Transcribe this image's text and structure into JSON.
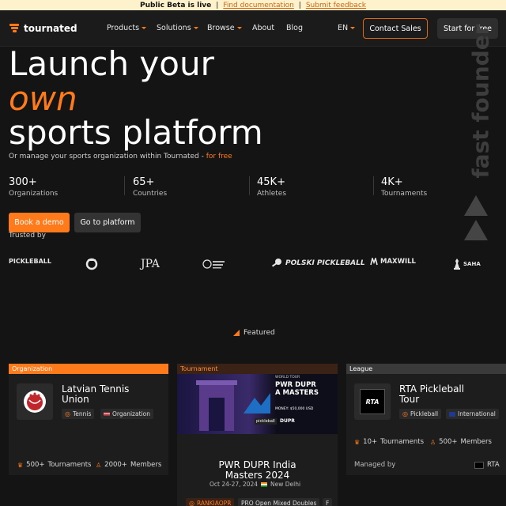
{
  "banner": {
    "status": "Public Beta is live",
    "sep": "|",
    "doc_link": "Find documentation",
    "feedback_link": "Submit feedback"
  },
  "nav": {
    "brand": "tournated",
    "items": [
      {
        "label": "Products",
        "dropdown": true
      },
      {
        "label": "Solutions",
        "dropdown": true
      },
      {
        "label": "Browse",
        "dropdown": true
      },
      {
        "label": "About",
        "dropdown": false
      },
      {
        "label": "Blog",
        "dropdown": false
      }
    ],
    "language": "EN",
    "contact_sales": "Contact Sales",
    "start_free": "Start for free"
  },
  "hero": {
    "line1": "Launch your",
    "line2": "own",
    "line3": "sports platform",
    "subtitle": "Or manage your sports organization within Tournated - ",
    "subtitle_highlight": "for free",
    "vertical_text": "fast founder",
    "stats": [
      {
        "value": "300+",
        "label": "Organizations"
      },
      {
        "value": "65+",
        "label": "Countries"
      },
      {
        "value": "45K+",
        "label": "Athletes"
      },
      {
        "value": "4K+",
        "label": "Tournaments"
      }
    ],
    "book_demo": "Book a demo",
    "go_platform": "Go to platform",
    "trusted_by": "Trusted by"
  },
  "trusted_logos": [
    "PICKLEBALL",
    "JPA",
    "POLSKI PICKLEBALL",
    "MAXWILL",
    "SAHA"
  ],
  "featured_label": "Featured",
  "accent_color": "#ff7a1a",
  "cards": [
    {
      "tag": "Organization",
      "title_line1": "Latvian Tennis",
      "title_line2": "Union",
      "chips": [
        {
          "label": "Tennis"
        },
        {
          "label": "Organization"
        }
      ],
      "meta": [
        {
          "value": "500+",
          "label": "Tournaments"
        },
        {
          "value": "2000+",
          "label": "Members"
        }
      ]
    },
    {
      "tag": "Tournament",
      "image_text": {
        "top": "WORLD TOUR",
        "title1": "PWR DUPR",
        "title2": "A MASTERS",
        "money": "MONEY: $50,000 USD",
        "sponsors": [
          "pickleball",
          "DUPR"
        ]
      },
      "title_line1": "PWR DUPR India",
      "title_line2": "Masters 2024",
      "date": "Oct 24-27, 2024",
      "location": "New Delhi",
      "chips": [
        {
          "label": "RANKIAOPR"
        },
        {
          "label": "PRO Open Mixed Doubles"
        },
        {
          "label": "F"
        }
      ]
    },
    {
      "tag": "League",
      "title_line1": "RTA Pickleball",
      "title_line2": "Tour",
      "logo_text": "RTA",
      "chips": [
        {
          "label": "Pickleball"
        },
        {
          "label": "International"
        }
      ],
      "meta": [
        {
          "value": "10+",
          "label": "Tournaments"
        },
        {
          "value": "500+",
          "label": "Members"
        }
      ],
      "managed_by": "Managed by",
      "manager": "RTA"
    }
  ]
}
